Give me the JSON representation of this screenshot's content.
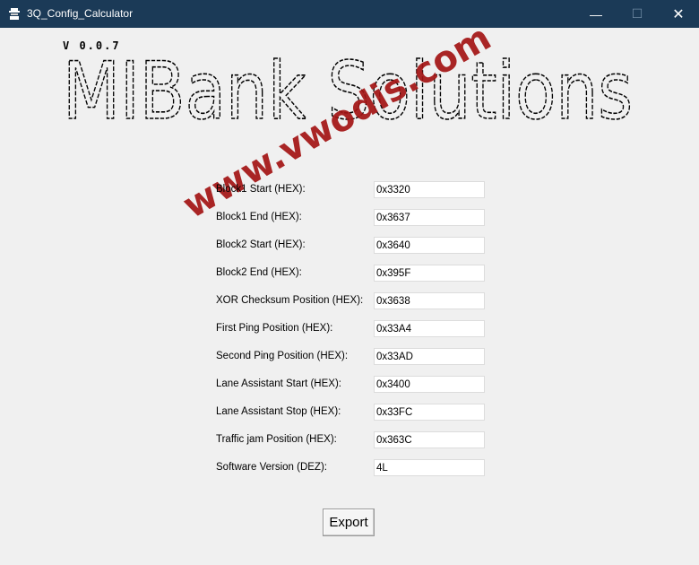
{
  "window": {
    "title": "3Q_Config_Calculator",
    "min_glyph": "—",
    "max_glyph": "☐",
    "close_glyph": "✕"
  },
  "version": "V 0.0.7",
  "banner_text": "MIBank Solutions",
  "watermark": "www.vwodis.com",
  "fields": [
    {
      "label": "Block1 Start (HEX):",
      "value": "0x3320"
    },
    {
      "label": "Block1 End (HEX):",
      "value": "0x3637"
    },
    {
      "label": "Block2 Start (HEX):",
      "value": "0x3640"
    },
    {
      "label": "Block2 End (HEX):",
      "value": "0x395F"
    },
    {
      "label": "XOR Checksum Position (HEX):",
      "value": "0x3638"
    },
    {
      "label": "First Ping Position (HEX):",
      "value": "0x33A4"
    },
    {
      "label": "Second Ping Position (HEX):",
      "value": "0x33AD"
    },
    {
      "label": "Lane Assistant Start (HEX):",
      "value": "0x3400"
    },
    {
      "label": "Lane Assistant Stop (HEX):",
      "value": "0x33FC"
    },
    {
      "label": "Traffic jam Position (HEX):",
      "value": "0x363C"
    },
    {
      "label": "Software Version (DEZ):",
      "value": "4L"
    }
  ],
  "export_label": "Export",
  "colors": {
    "titlebar": "#1b3a57",
    "background": "#f0f0f0",
    "watermark": "#a31414"
  }
}
